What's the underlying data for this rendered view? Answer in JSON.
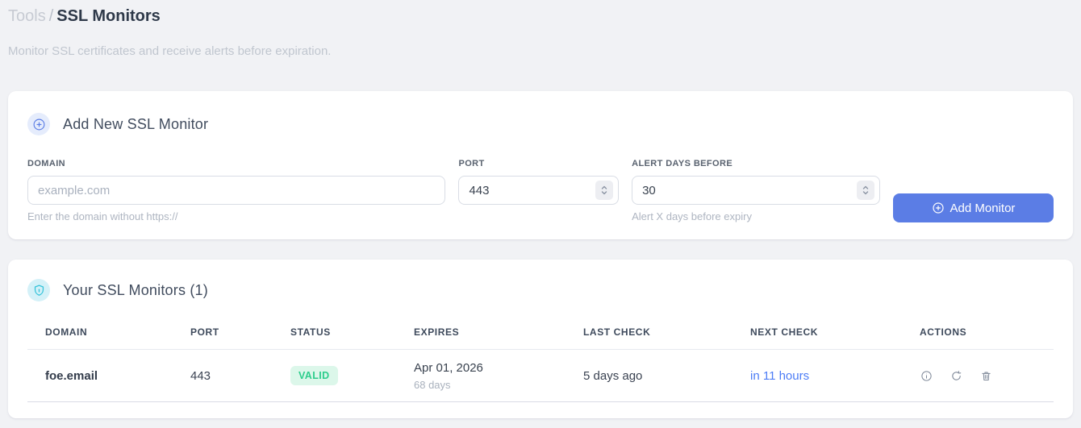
{
  "breadcrumb": {
    "section": "Tools",
    "separator": "/",
    "current": "SSL Monitors"
  },
  "subtitle": "Monitor SSL certificates and receive alerts before expiration.",
  "add_form": {
    "icon": "plus-circle-icon",
    "title": "Add New SSL Monitor",
    "fields": {
      "domain": {
        "label": "DOMAIN",
        "placeholder": "example.com",
        "value": "",
        "helper": "Enter the domain without https://"
      },
      "port": {
        "label": "PORT",
        "value": "443"
      },
      "alert_days": {
        "label": "ALERT DAYS BEFORE",
        "value": "30",
        "helper": "Alert X days before expiry"
      }
    },
    "submit_label": "Add Monitor",
    "submit_icon": "plus-circle-icon"
  },
  "monitors": {
    "icon": "shield-icon",
    "title": "Your SSL Monitors (1)",
    "count": 1,
    "table": {
      "headers": [
        "DOMAIN",
        "PORT",
        "STATUS",
        "EXPIRES",
        "LAST CHECK",
        "NEXT CHECK",
        "ACTIONS"
      ],
      "rows": [
        {
          "domain": "foe.email",
          "port": "443",
          "status": "VALID",
          "expires_date": "Apr 01, 2026",
          "expires_days": "68 days",
          "last_check": "5 days ago",
          "next_check": "in 11 hours",
          "action_icons": [
            "info-icon",
            "refresh-icon",
            "trash-icon"
          ]
        }
      ]
    }
  },
  "colors": {
    "primary_button": "#5b7de5",
    "status_valid_text": "#2dcd8c",
    "status_valid_bg": "#dcf7ea",
    "next_check_link": "#4c7cf6",
    "shield_accent": "#35c3da",
    "page_background": "#f1f2f5"
  }
}
